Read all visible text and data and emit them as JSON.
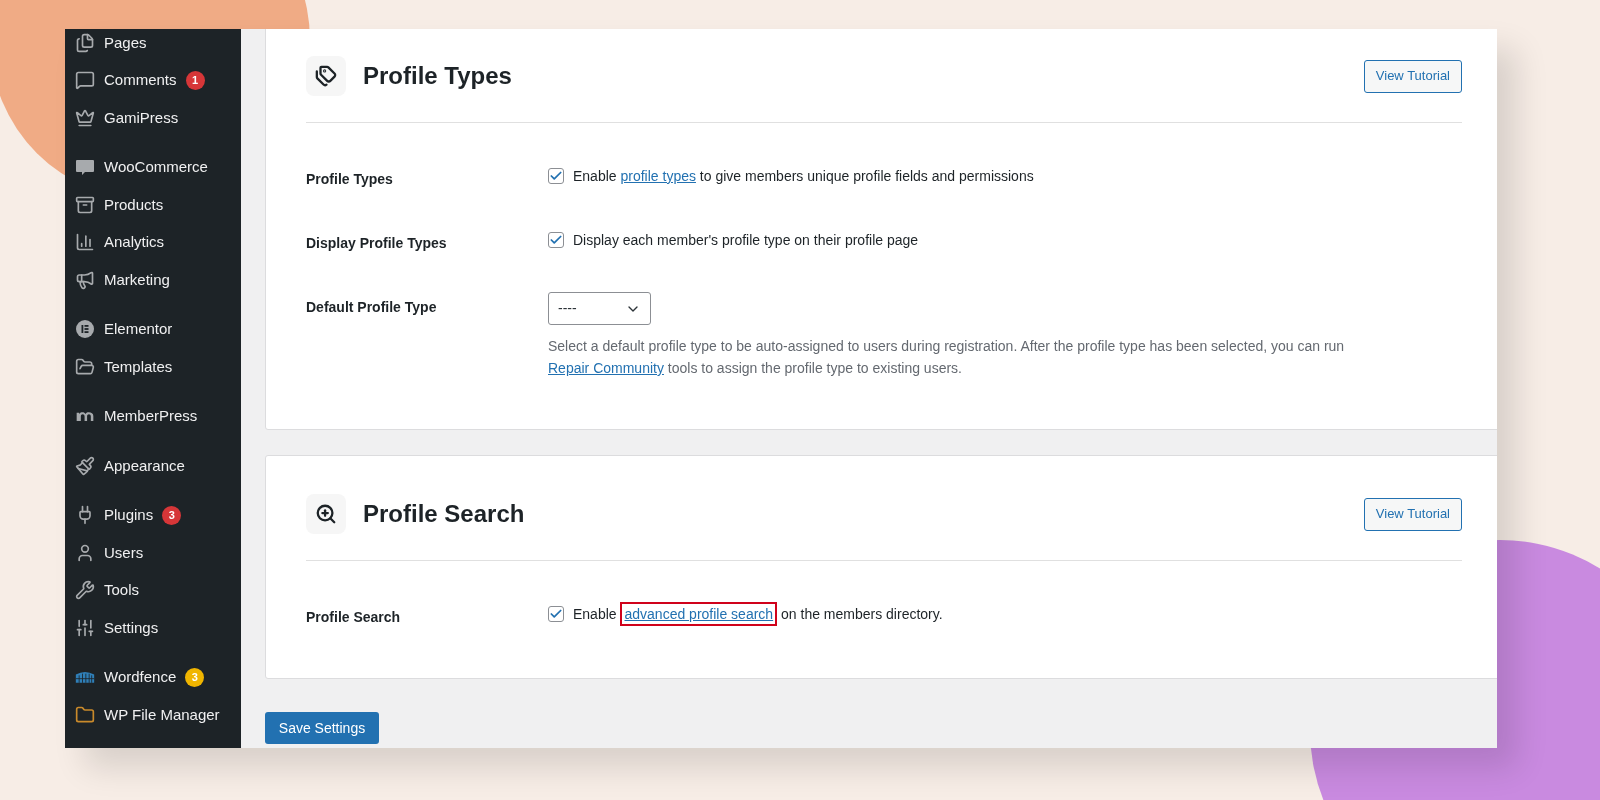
{
  "sidebar": {
    "groups": [
      {
        "items": [
          {
            "label": "Pages"
          },
          {
            "label": "Comments",
            "badge": "1",
            "color": "#d63638"
          },
          {
            "label": "GamiPress"
          }
        ]
      },
      {
        "items": [
          {
            "label": "WooCommerce"
          },
          {
            "label": "Products"
          },
          {
            "label": "Analytics"
          },
          {
            "label": "Marketing"
          }
        ]
      },
      {
        "items": [
          {
            "label": "Elementor"
          },
          {
            "label": "Templates"
          }
        ]
      },
      {
        "items": [
          {
            "label": "MemberPress"
          }
        ]
      },
      {
        "items": [
          {
            "label": "Appearance"
          }
        ]
      },
      {
        "items": [
          {
            "label": "Plugins",
            "badge": "3",
            "color": "#d63638"
          },
          {
            "label": "Users"
          },
          {
            "label": "Tools"
          },
          {
            "label": "Settings"
          }
        ]
      },
      {
        "items": [
          {
            "label": "Wordfence",
            "badge": "3",
            "color": "#f0b500"
          },
          {
            "label": "WP File Manager"
          }
        ]
      }
    ]
  },
  "sections": [
    {
      "title": "Profile Types",
      "button": "View Tutorial",
      "rows": [
        {
          "label": "Profile Types",
          "kind": "checkbox",
          "checked": true,
          "text": [
            {
              "kind": "text",
              "text": "Enable "
            },
            {
              "kind": "link",
              "text": "profile types"
            },
            {
              "kind": "text",
              "text": " to give members unique profile fields and permissions"
            }
          ]
        },
        {
          "label": "Display Profile Types",
          "kind": "checkbox",
          "checked": true,
          "text": [
            {
              "kind": "text",
              "text": "Display each member's profile type on their profile page"
            }
          ]
        },
        {
          "label": "Default Profile Type",
          "kind": "select",
          "value": "----",
          "text": [
            {
              "kind": "text",
              "text": "Select a default profile type to be auto-assigned to users during registration. After the profile type has been selected, you can run "
            },
            {
              "kind": "link",
              "text": "Repair Community"
            },
            {
              "kind": "text",
              "text": " tools to assign the profile type to existing users."
            }
          ]
        }
      ]
    },
    {
      "title": "Profile Search",
      "button": "View Tutorial",
      "rows": [
        {
          "label": "Profile Search",
          "kind": "checkbox",
          "checked": true,
          "text": [
            {
              "kind": "text",
              "text": "Enable "
            },
            {
              "kind": "link",
              "text": "advanced profile search",
              "highlighted": true
            },
            {
              "kind": "text",
              "text": " on the members directory."
            }
          ]
        }
      ]
    }
  ],
  "save_button": "Save Settings"
}
